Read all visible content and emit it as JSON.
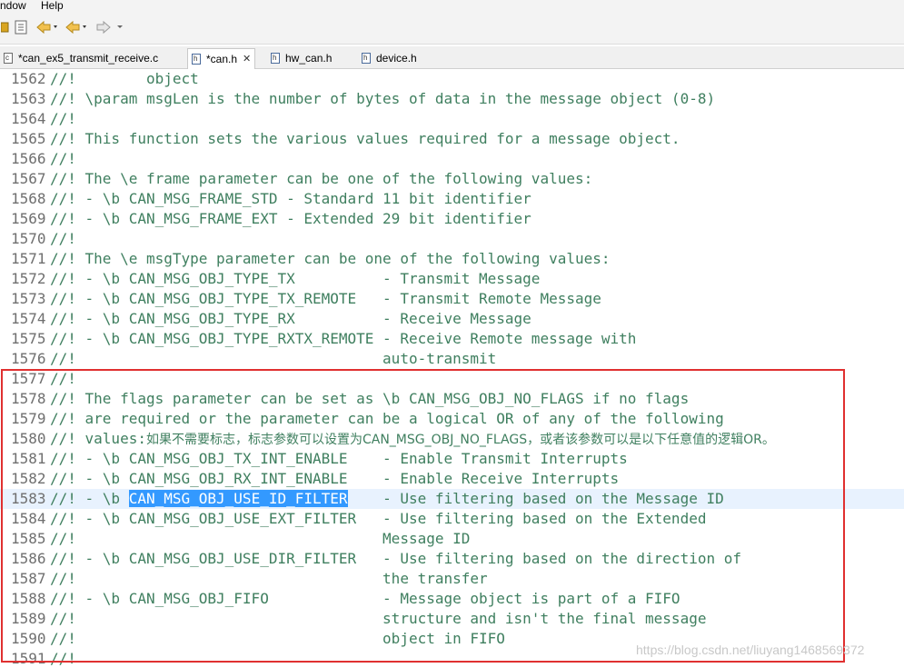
{
  "menu": {
    "window_label": "ndow",
    "help_label": "Help"
  },
  "toolbar": {
    "icons": [
      "project-icon",
      "outline-icon",
      "back-nav-icon",
      "forward-nav-icon"
    ]
  },
  "tabs": [
    {
      "label": "*can_ex5_transmit_receive.c",
      "icon_letter": "c",
      "active": false
    },
    {
      "label": "*can.h",
      "icon_letter": "h",
      "active": true
    },
    {
      "label": "hw_can.h",
      "icon_letter": "h",
      "active": false
    },
    {
      "label": "device.h",
      "icon_letter": "h",
      "active": false
    }
  ],
  "code_lines": [
    {
      "num": "1562",
      "pre": "//!        object",
      "sel": "",
      "post": ""
    },
    {
      "num": "1563",
      "pre": "//! \\param msgLen is the number of bytes of data in the message object (0-8)",
      "sel": "",
      "post": ""
    },
    {
      "num": "1564",
      "pre": "//!",
      "sel": "",
      "post": ""
    },
    {
      "num": "1565",
      "pre": "//! This function sets the various values required for a message object.",
      "sel": "",
      "post": ""
    },
    {
      "num": "1566",
      "pre": "//!",
      "sel": "",
      "post": ""
    },
    {
      "num": "1567",
      "pre": "//! The \\e frame parameter can be one of the following values:",
      "sel": "",
      "post": ""
    },
    {
      "num": "1568",
      "pre": "//! - \\b CAN_MSG_FRAME_STD - Standard 11 bit identifier",
      "sel": "",
      "post": ""
    },
    {
      "num": "1569",
      "pre": "//! - \\b CAN_MSG_FRAME_EXT - Extended 29 bit identifier",
      "sel": "",
      "post": ""
    },
    {
      "num": "1570",
      "pre": "//!",
      "sel": "",
      "post": ""
    },
    {
      "num": "1571",
      "pre": "//! The \\e msgType parameter can be one of the following values:",
      "sel": "",
      "post": ""
    },
    {
      "num": "1572",
      "pre": "//! - \\b CAN_MSG_OBJ_TYPE_TX          - Transmit Message",
      "sel": "",
      "post": ""
    },
    {
      "num": "1573",
      "pre": "//! - \\b CAN_MSG_OBJ_TYPE_TX_REMOTE   - Transmit Remote Message",
      "sel": "",
      "post": ""
    },
    {
      "num": "1574",
      "pre": "//! - \\b CAN_MSG_OBJ_TYPE_RX          - Receive Message",
      "sel": "",
      "post": ""
    },
    {
      "num": "1575",
      "pre": "//! - \\b CAN_MSG_OBJ_TYPE_RXTX_REMOTE - Receive Remote message with",
      "sel": "",
      "post": ""
    },
    {
      "num": "1576",
      "pre": "//!                                   auto-transmit",
      "sel": "",
      "post": ""
    },
    {
      "num": "1577",
      "pre": "//!",
      "sel": "",
      "post": ""
    },
    {
      "num": "1578",
      "pre": "//! The flags parameter can be set as \\b CAN_MSG_OBJ_NO_FLAGS if no flags",
      "sel": "",
      "post": ""
    },
    {
      "num": "1579",
      "pre": "//! are required or the parameter can be a logical OR of any of the following",
      "sel": "",
      "post": ""
    },
    {
      "num": "1580",
      "pre": "//! values:",
      "sel": "",
      "post": "",
      "cjk": "如果不需要标志，标志参数可以设置为CAN_MSG_OBJ_NO_FLAGS，或者该参数可以是以下任意值的逻辑OR。"
    },
    {
      "num": "1581",
      "pre": "//! - \\b CAN_MSG_OBJ_TX_INT_ENABLE    - Enable Transmit Interrupts",
      "sel": "",
      "post": ""
    },
    {
      "num": "1582",
      "pre": "//! - \\b CAN_MSG_OBJ_RX_INT_ENABLE    - Enable Receive Interrupts",
      "sel": "",
      "post": ""
    },
    {
      "num": "1583",
      "pre": "//! - \\b ",
      "sel": "CAN_MSG_OBJ_USE_ID_FILTER",
      "post": "    - Use filtering based on the Message ID",
      "current": true
    },
    {
      "num": "1584",
      "pre": "//! - \\b CAN_MSG_OBJ_USE_EXT_FILTER   - Use filtering based on the Extended",
      "sel": "",
      "post": ""
    },
    {
      "num": "1585",
      "pre": "//!                                   Message ID",
      "sel": "",
      "post": ""
    },
    {
      "num": "1586",
      "pre": "//! - \\b CAN_MSG_OBJ_USE_DIR_FILTER   - Use filtering based on the direction of",
      "sel": "",
      "post": ""
    },
    {
      "num": "1587",
      "pre": "//!                                   the transfer",
      "sel": "",
      "post": ""
    },
    {
      "num": "1588",
      "pre": "//! - \\b CAN_MSG_OBJ_FIFO             - Message object is part of a FIFO",
      "sel": "",
      "post": ""
    },
    {
      "num": "1589",
      "pre": "//!                                   structure and isn't the final message",
      "sel": "",
      "post": ""
    },
    {
      "num": "1590",
      "pre": "//!                                   object in FIFO",
      "sel": "",
      "post": ""
    },
    {
      "num": "1591",
      "pre": "//!",
      "sel": "",
      "post": ""
    }
  ],
  "watermark": "https://blog.csdn.net/liuyang1468569372",
  "colors": {
    "comment": "#3f7f5f",
    "selection": "#3399ff",
    "current_line": "#e8f2fe",
    "annotation_box": "#e03030"
  }
}
